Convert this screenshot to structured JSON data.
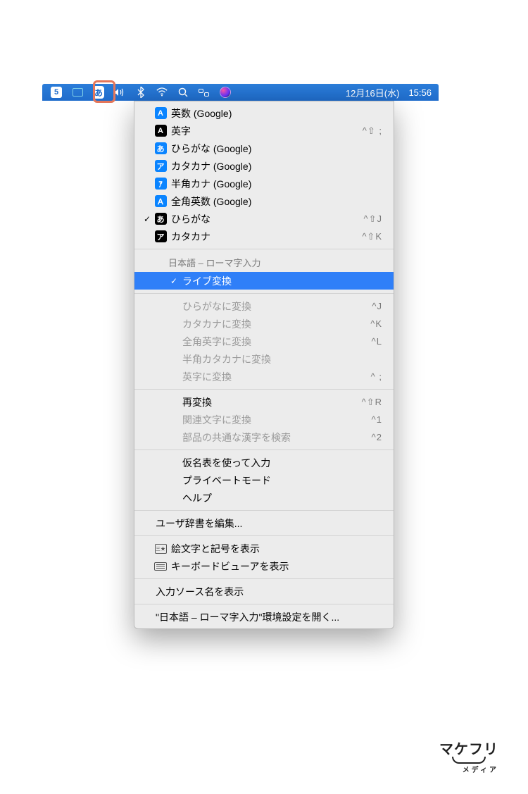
{
  "menubar": {
    "date": "12月16日(水)",
    "time": "15:56",
    "ime_char": "あ",
    "badge5": "5"
  },
  "menu": {
    "sources": [
      {
        "icon": "A",
        "badge": "blue",
        "label": "英数 (Google)",
        "shortcut": ""
      },
      {
        "icon": "A",
        "badge": "black",
        "label": "英字",
        "shortcut": "^⇧ ;"
      },
      {
        "icon": "あ",
        "badge": "blue",
        "label": "ひらがな (Google)",
        "shortcut": ""
      },
      {
        "icon": "ア",
        "badge": "blue",
        "label": "カタカナ (Google)",
        "shortcut": ""
      },
      {
        "icon": "ｱ",
        "badge": "blue",
        "label": "半角カナ (Google)",
        "shortcut": ""
      },
      {
        "icon": "Ａ",
        "badge": "blue",
        "label": "全角英数 (Google)",
        "shortcut": ""
      },
      {
        "icon": "あ",
        "badge": "black",
        "label": "ひらがな",
        "shortcut": "^⇧J",
        "checked": true
      },
      {
        "icon": "ア",
        "badge": "black",
        "label": "カタカナ",
        "shortcut": "^⇧K"
      }
    ],
    "section_header": "日本語 – ローマ字入力",
    "live_convert": "ライブ変換",
    "conversions": [
      {
        "label": "ひらがなに変換",
        "shortcut": "^J"
      },
      {
        "label": "カタカナに変換",
        "shortcut": "^K"
      },
      {
        "label": "全角英字に変換",
        "shortcut": "^L"
      },
      {
        "label": "半角カタカナに変換",
        "shortcut": ""
      },
      {
        "label": "英字に変換",
        "shortcut": "^ ;"
      }
    ],
    "reconvert": [
      {
        "label": "再変換",
        "shortcut": "^⇧R",
        "disabled": false
      },
      {
        "label": "関連文字に変換",
        "shortcut": "^1",
        "disabled": true
      },
      {
        "label": "部品の共通な漢字を検索",
        "shortcut": "^2",
        "disabled": true
      }
    ],
    "options": [
      {
        "label": "仮名表を使って入力"
      },
      {
        "label": "プライベートモード"
      },
      {
        "label": "ヘルプ"
      }
    ],
    "edit_dict": "ユーザ辞書を編集...",
    "viewers": [
      {
        "icon": "emoji",
        "label": "絵文字と記号を表示"
      },
      {
        "icon": "keyboard",
        "label": "キーボードビューアを表示"
      }
    ],
    "show_name": "入力ソース名を表示",
    "prefs": "\"日本語 – ローマ字入力\"環境設定を開く..."
  },
  "watermark": {
    "main": "マケフリ",
    "sub": "メディア"
  }
}
